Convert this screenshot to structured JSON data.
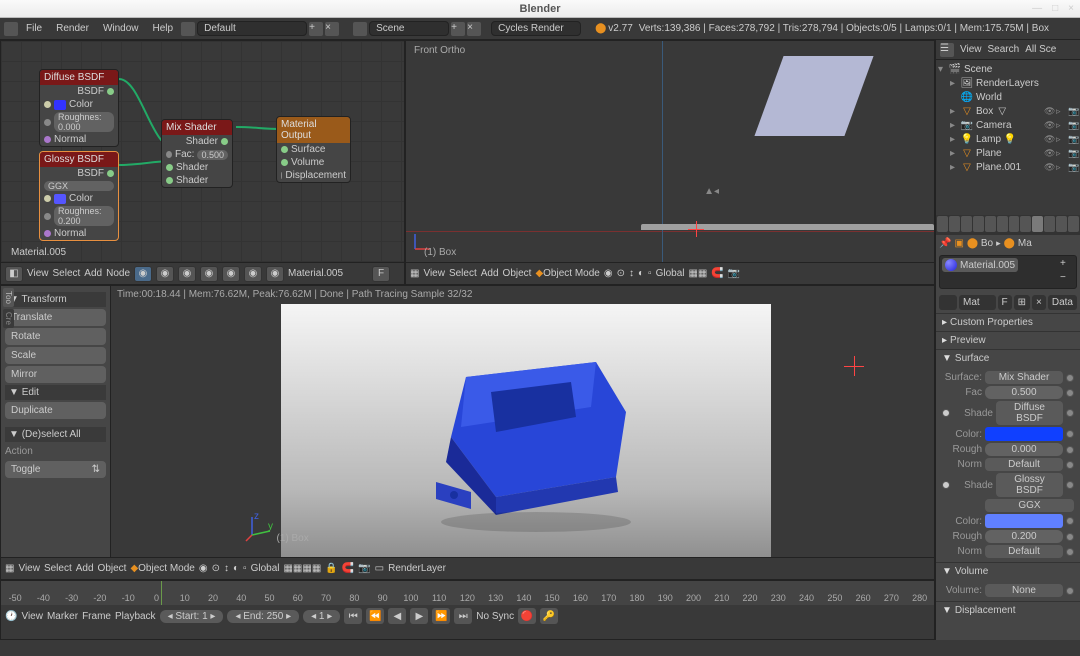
{
  "app": {
    "title": "Blender"
  },
  "menu": {
    "file": "File",
    "render": "Render",
    "window": "Window",
    "help": "Help"
  },
  "layout": "Default",
  "scene": "Scene",
  "engine": "Cycles Render",
  "version": "v2.77",
  "stats": "Verts:139,386 | Faces:278,792 | Tris:278,794 | Objects:0/5 | Lamps:0/1 | Mem:175.75M | Box",
  "nodeEditor": {
    "material": "Material.005",
    "hdr": {
      "view": "View",
      "select": "Select",
      "add": "Add",
      "node": "Node"
    },
    "nodes": {
      "diffuse": {
        "title": "Diffuse BSDF",
        "bsdf": "BSDF",
        "color": "Color",
        "rough": "Roughnes: 0.000",
        "normal": "Normal"
      },
      "glossy": {
        "title": "Glossy BSDF",
        "bsdf": "BSDF",
        "dist": "GGX",
        "color": "Color",
        "rough": "Roughnes: 0.200",
        "normal": "Normal"
      },
      "mix": {
        "title": "Mix Shader",
        "shader": "Shader",
        "fac": "Fac:",
        "facv": "0.500",
        "s1": "Shader",
        "s2": "Shader"
      },
      "output": {
        "title": "Material Output",
        "surface": "Surface",
        "volume": "Volume",
        "disp": "Displacement"
      }
    }
  },
  "viewport": {
    "label": "Front Ortho",
    "obj": "(1) Box",
    "mode": "Object Mode",
    "orient": "Global",
    "hdr": {
      "view": "View",
      "select": "Select",
      "add": "Add",
      "object": "Object"
    }
  },
  "imageEditor": {
    "info": "Time:00:18.44 | Mem:76.62M, Peak:76.62M | Done | Path Tracing Sample 32/32",
    "obj": "(1) Box",
    "mode": "Object Mode",
    "orient": "Global",
    "layer": "RenderLayer",
    "hdr": {
      "view": "View",
      "select": "Select",
      "add": "Add",
      "object": "Object"
    },
    "tools": {
      "transform": "Transform",
      "translate": "Translate",
      "rotate": "Rotate",
      "scale": "Scale",
      "mirror": "Mirror",
      "edit": "Edit",
      "duplicate": "Duplicate",
      "desel": "(De)select All",
      "action": "Action",
      "toggle": "Toggle"
    }
  },
  "timeline": {
    "ticks": [
      "-50",
      "-40",
      "-30",
      "-20",
      "-10",
      "0",
      "10",
      "20",
      "40",
      "50",
      "60",
      "70",
      "80",
      "90",
      "100",
      "110",
      "120",
      "130",
      "140",
      "150",
      "160",
      "170",
      "180",
      "190",
      "200",
      "210",
      "220",
      "230",
      "240",
      "250",
      "260",
      "270",
      "280"
    ],
    "hdr": {
      "view": "View",
      "marker": "Marker",
      "frame": "Frame",
      "playback": "Playback"
    },
    "start": "Start:",
    "startv": "1",
    "end": "End:",
    "endv": "250",
    "cur": "1",
    "sync": "No Sync"
  },
  "outliner": {
    "hdr": {
      "view": "View",
      "search": "Search",
      "filter": "All Sce"
    },
    "tree": {
      "scene": "Scene",
      "rl": "RenderLayers",
      "world": "World",
      "box": "Box",
      "camera": "Camera",
      "lamp": "Lamp",
      "plane": "Plane",
      "plane1": "Plane.001"
    }
  },
  "props": {
    "bc": {
      "obj": "Bo",
      "mat": "Ma"
    },
    "mat": "Material.005",
    "matfld": "Mat",
    "data": "Data",
    "panels": {
      "custom": "Custom Properties",
      "preview": "Preview",
      "surface": "Surface",
      "volume": "Volume",
      "disp": "Displacement"
    },
    "surface": {
      "surflbl": "Surface:",
      "surf": "Mix Shader",
      "faclbl": "Fac",
      "fac": "0.500",
      "shadelbl": "Shade",
      "shade1": "Diffuse BSDF",
      "colorlbl": "Color:",
      "roughlbl": "Rough",
      "rough1": "0.000",
      "normlbl": "Norm",
      "norm": "Default",
      "shade2": "Glossy BSDF",
      "dist": "GGX",
      "rough2": "0.200"
    },
    "volume": {
      "lbl": "Volume:",
      "val": "None"
    }
  }
}
